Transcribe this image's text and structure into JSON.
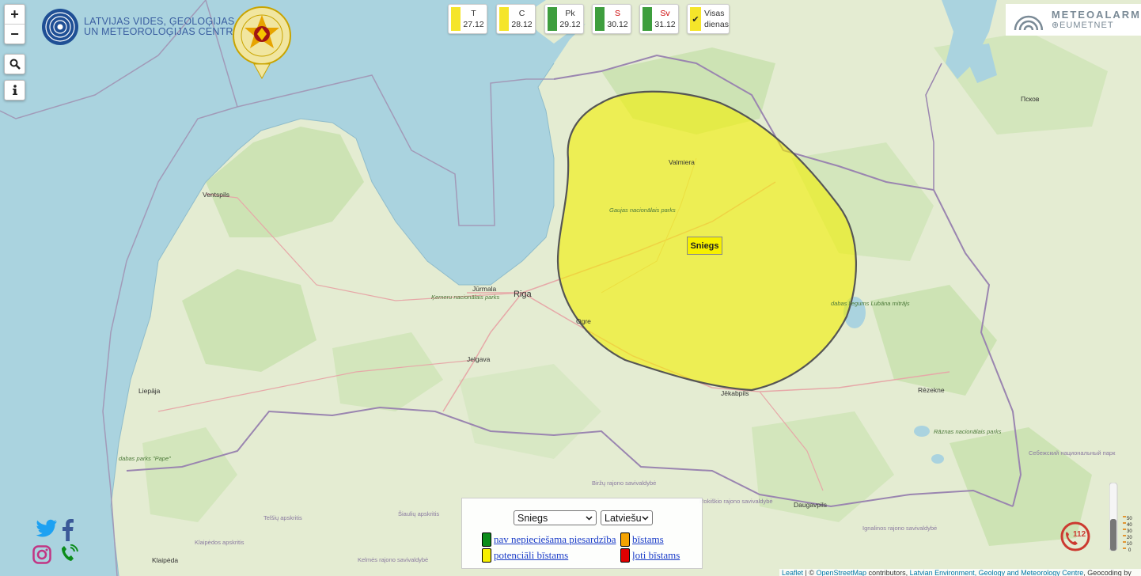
{
  "map": {
    "warning_label": "Sniegs",
    "cities": [
      {
        "name": "Riga"
      },
      {
        "name": "Jūrmala"
      },
      {
        "name": "Ventspils"
      },
      {
        "name": "Liepāja"
      },
      {
        "name": "Jelgava"
      },
      {
        "name": "Ogre"
      },
      {
        "name": "Valmiera"
      },
      {
        "name": "Jēkabpils"
      },
      {
        "name": "Rēzekne"
      },
      {
        "name": "Daugavpils"
      },
      {
        "name": "Klaipėda"
      },
      {
        "name": "Псков"
      }
    ],
    "park_labels": [
      "Ķemeru nacionālais parks",
      "Gaujas nacionālais parks",
      "dabas liegums Lubāna mitrājs",
      "dabas parks \"Pape\"",
      "Rāznas nacionālais parks"
    ],
    "region_labels": [
      "Telšių apskritis",
      "Šiaulių apskritis",
      "Biržų rajono savivaldybė",
      "Klaipėdos apskritis",
      "Kelmės rajono savivaldybė",
      "Rokiškio rajono savivaldybė",
      "Себежский национальный парк",
      "Ignalinos rajono savivaldybė"
    ]
  },
  "zoom": {
    "in": "+",
    "out": "−"
  },
  "logos": {
    "lvgmc_line1": "LATVIJAS VIDES, ĢEOLOĢIJAS",
    "lvgmc_line2": "UN METEOROLOĢIJAS CENTRS",
    "meteoalarm": "METEOALARM",
    "eumetnet": "EUMETNET"
  },
  "days": [
    {
      "name": "T",
      "date": "27.12",
      "color": "#f5e52a",
      "name_red": false
    },
    {
      "name": "C",
      "date": "28.12",
      "color": "#f5e52a",
      "name_red": false
    },
    {
      "name": "Pk",
      "date": "29.12",
      "color": "#3e9e3e",
      "name_red": false
    },
    {
      "name": "S",
      "date": "30.12",
      "color": "#3e9e3e",
      "name_red": true
    },
    {
      "name": "Sv",
      "date": "31.12",
      "color": "#3e9e3e",
      "name_red": true
    }
  ],
  "all_days": {
    "line1": "Visas",
    "line2": "dienas",
    "checked": true
  },
  "legend": {
    "phenomenon_select": "Sniegs",
    "language_select": "Latviešu",
    "items": [
      {
        "label": "nav nepieciešama piesardzība",
        "color": "#0b8c1a"
      },
      {
        "label": "bīstams",
        "color": "#f5a300"
      },
      {
        "label": "potenciāli bīstams",
        "color": "#f7f000"
      },
      {
        "label": "ļoti bīstams",
        "color": "#e00000"
      }
    ]
  },
  "emergency": "112",
  "scale_ticks": [
    "50",
    "40",
    "30",
    "20",
    "10",
    "0"
  ],
  "attribution": {
    "leaflet": "Leaflet",
    "sep": " | © ",
    "osm": "OpenStreetMap",
    "contributors": " contributors, ",
    "lvgmc": "Latvian Environment, Geology and Meteorology Centre",
    "extra": ", Geocoding by"
  }
}
